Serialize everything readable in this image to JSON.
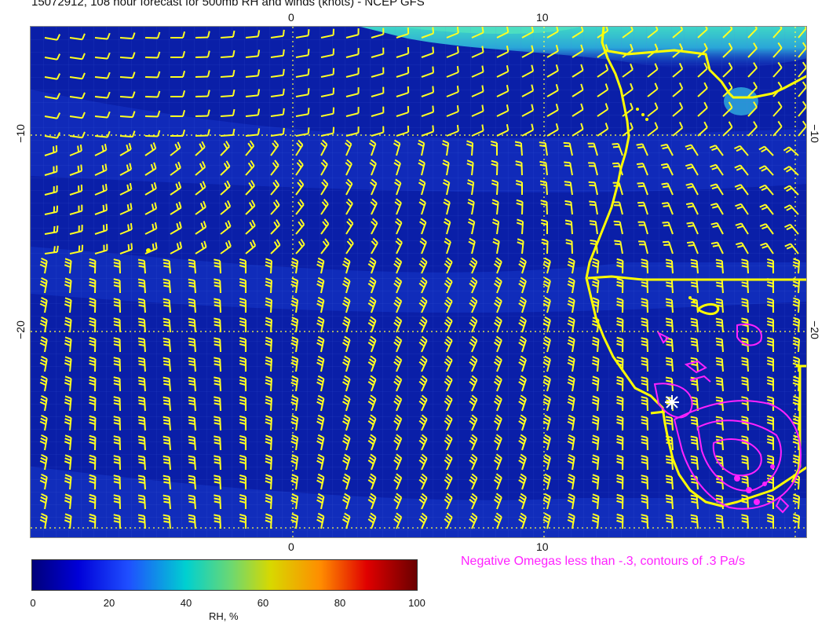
{
  "title": "15072912, 108 hour forecast for 500mb RH and winds (knots) - NCEP GFS",
  "map": {
    "lon_ticks_top": [
      "0",
      "10"
    ],
    "lon_ticks_bottom": [
      "0",
      "10"
    ],
    "lat_ticks_left": [
      "−10",
      "−20"
    ],
    "lat_ticks_right": [
      "−10",
      "−20"
    ],
    "colors": {
      "background_blue": "#0a1fa8",
      "band_blue": "#1d3fd0",
      "moist_cyan": "#33c8c8",
      "barb_yellow": "#ffff22",
      "coast_yellow": "#ffff00",
      "omega_magenta": "#ff22ff"
    }
  },
  "omega_note": "Negative Omegas less than -.3, contours of .3 Pa/s",
  "colorbar": {
    "ticks": [
      "0",
      "20",
      "40",
      "60",
      "80",
      "100"
    ],
    "label": "RH, %"
  }
}
